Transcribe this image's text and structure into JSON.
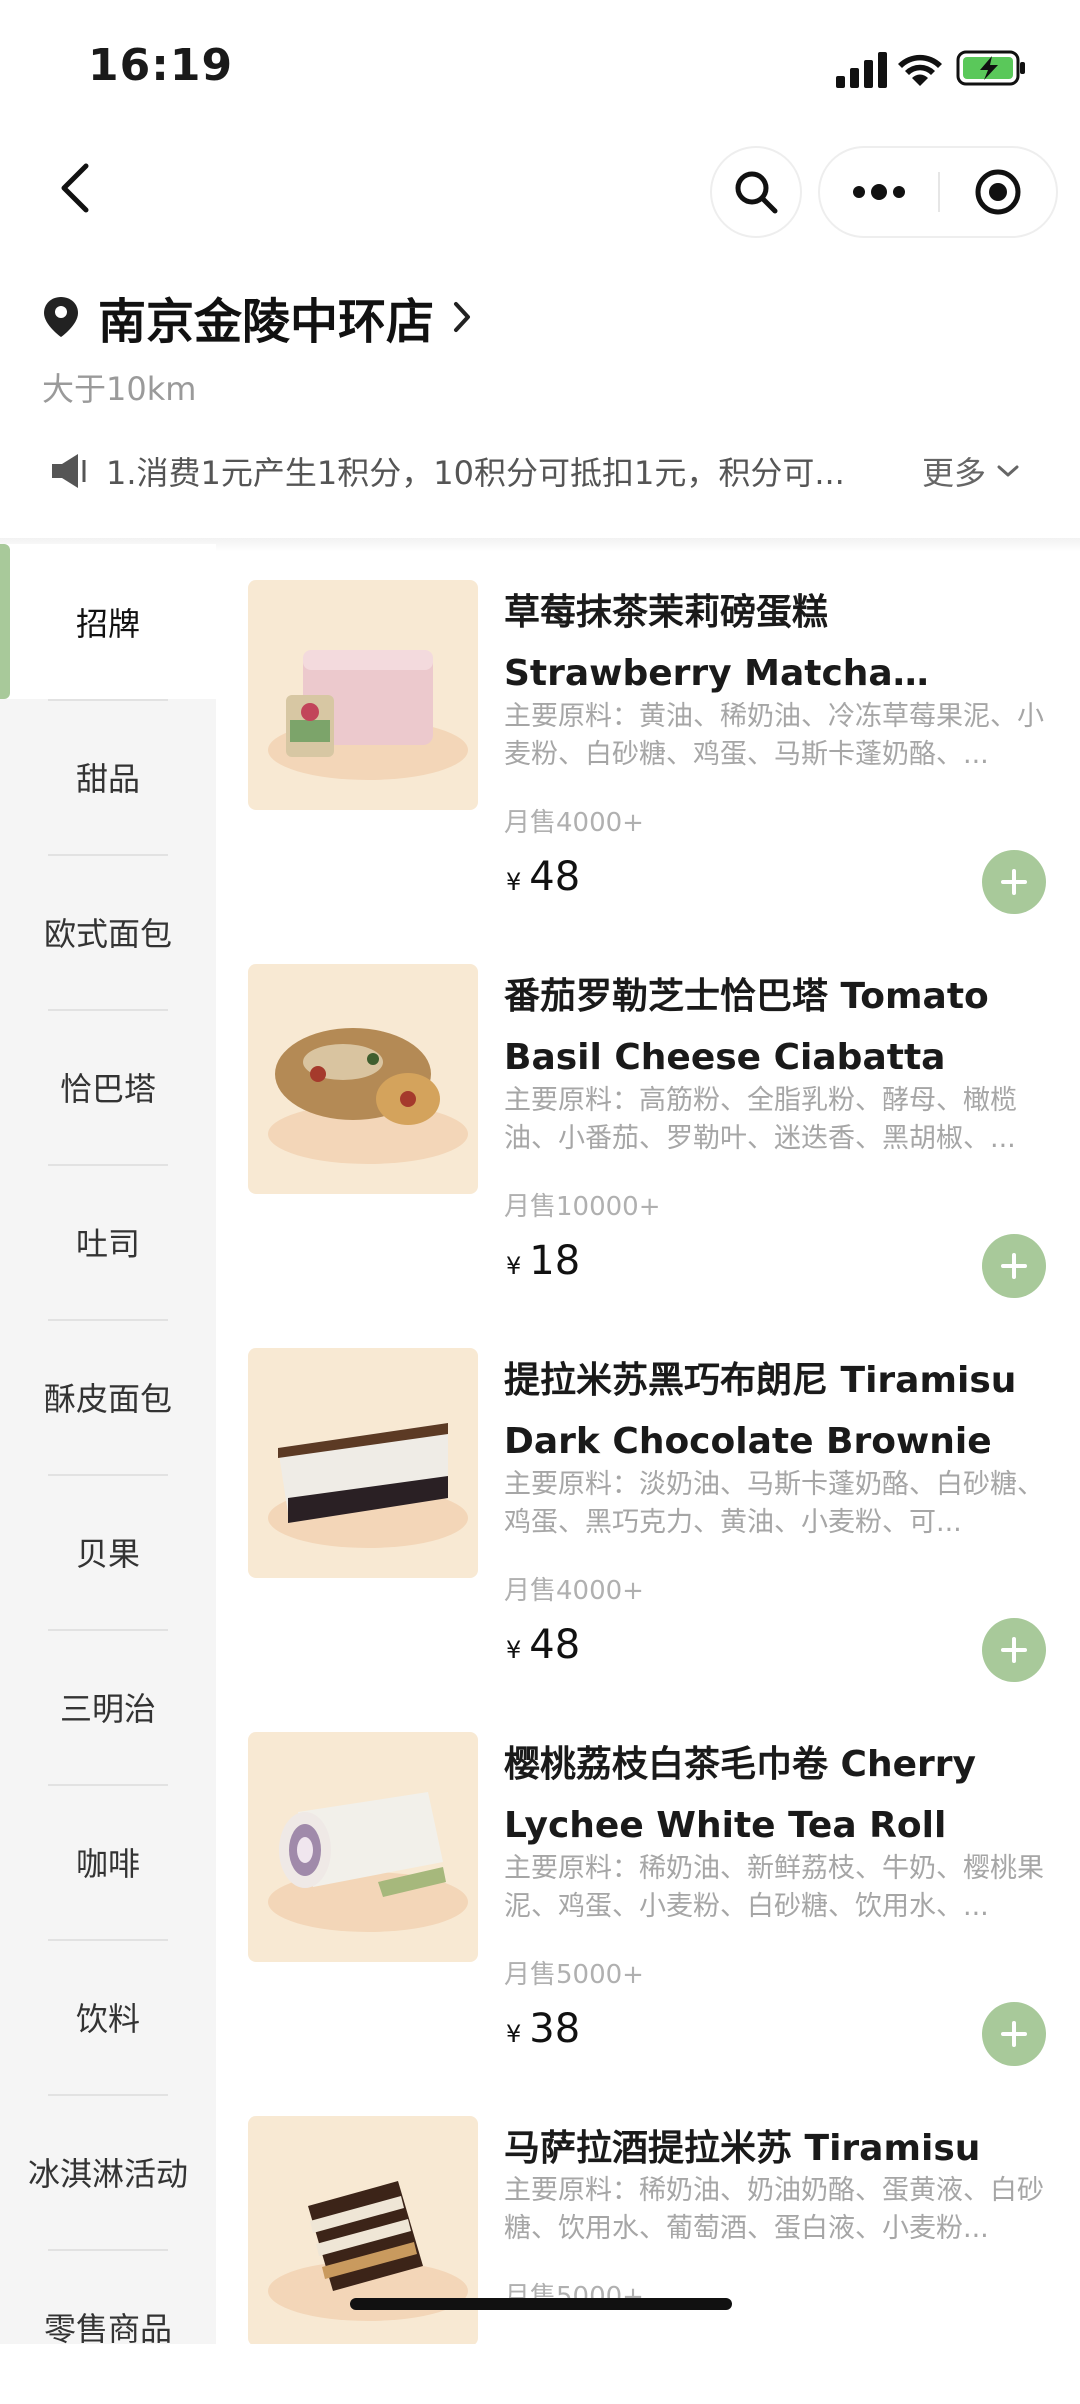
{
  "status_bar": {
    "time": "16:19"
  },
  "store": {
    "name": "南京金陵中环店",
    "distance": "大于10km",
    "notice": "1.消费1元产生1积分，10积分可抵扣1元，积分可...",
    "more_label": "更多"
  },
  "categories": [
    {
      "label": "招牌",
      "active": true
    },
    {
      "label": "甜品"
    },
    {
      "label": "欧式面包"
    },
    {
      "label": "恰巴塔"
    },
    {
      "label": "吐司"
    },
    {
      "label": "酥皮面包"
    },
    {
      "label": "贝果"
    },
    {
      "label": "三明治"
    },
    {
      "label": "咖啡"
    },
    {
      "label": "饮料"
    },
    {
      "label": "冰淇淋活动"
    },
    {
      "label": "零售商品"
    }
  ],
  "products": [
    {
      "name": "草莓抹茶茉莉磅蛋糕 Strawberry Matcha Jasmin...",
      "desc": "主要原料：黄油、稀奶油、冷冻草莓果泥、小麦粉、白砂糖、鸡蛋、马斯卡蓬奶酪、...",
      "sales": "月售4000+",
      "currency": "¥",
      "price": "48"
    },
    {
      "name": "番茄罗勒芝士恰巴塔 Tomato Basil Cheese Ciabatta",
      "desc": "主要原料：高筋粉、全脂乳粉、酵母、橄榄油、小番茄、罗勒叶、迷迭香、黑胡椒、...",
      "sales": "月售10000+",
      "currency": "¥",
      "price": "18"
    },
    {
      "name": "提拉米苏黑巧布朗尼 Tiramisu Dark Chocolate Brownie",
      "desc": "主要原料：淡奶油、马斯卡蓬奶酪、白砂糖、鸡蛋、黑巧克力、黄油、小麦粉、可...",
      "sales": "月售4000+",
      "currency": "¥",
      "price": "48"
    },
    {
      "name": "樱桃荔枝白茶毛巾卷 Cherry Lychee White Tea Roll",
      "desc": "主要原料：稀奶油、新鲜荔枝、牛奶、樱桃果泥、鸡蛋、小麦粉、白砂糖、饮用水、...",
      "sales": "月售5000+",
      "currency": "¥",
      "price": "38"
    },
    {
      "name": "马萨拉酒提拉米苏 Tiramisu",
      "desc": "主要原料：稀奶油、奶油奶酪、蛋黄液、白砂糖、饮用水、葡萄酒、蛋白液、小麦粉...",
      "sales": "月售5000+",
      "currency": "¥",
      "price": ""
    }
  ],
  "colors": {
    "accent": "#a8c99a",
    "sidebar_bg": "#f5f5f5"
  }
}
